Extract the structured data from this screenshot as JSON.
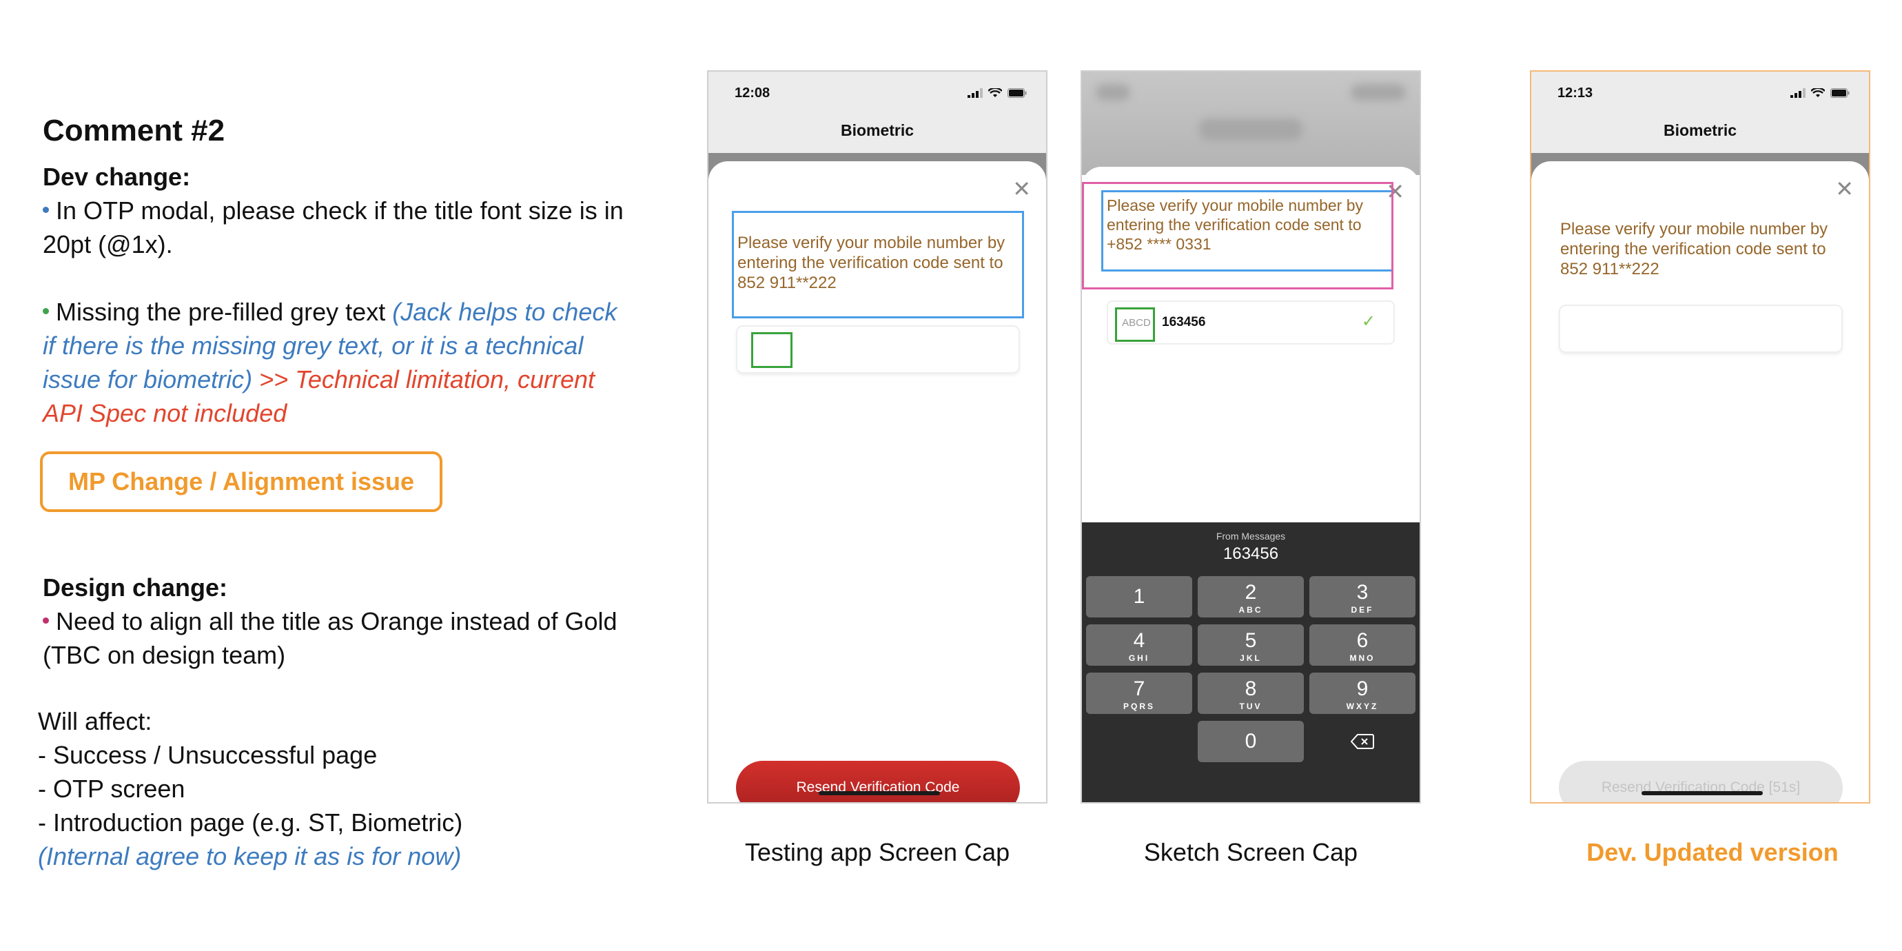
{
  "notes": {
    "title": "Comment #2",
    "dev_heading": "Dev change:",
    "dev_point1": "In OTP modal, please check if the title font size is in 20pt (@1x).",
    "dev_point2_prefix": "Missing the pre-filled grey text ",
    "dev_point2_query": "(Jack helps to check if there is the missing grey text, or it is a technical issue for biometric)",
    "dev_point2_answer": " >> Technical limitation, current API Spec not included",
    "tag_label": "MP Change / Alignment issue",
    "design_heading": "Design change:",
    "design_point": "Need to align all the title as Orange instead of Gold (TBC on design team)",
    "affect_heading": "Will affect:",
    "affect_items": [
      "- Success / Unsuccessful page",
      "- OTP screen",
      "- Introduction page (e.g. ST, Biometric)"
    ],
    "affect_note": "(Internal agree to keep it as is for now)",
    "colors": {
      "blue_bullet": "#3d7bbf",
      "green_bullet": "#3fa34d",
      "pink_bullet": "#c2306a",
      "orange": "#f19a2c",
      "red": "#e2452d",
      "gold_text": "#96662b"
    }
  },
  "testing_phone": {
    "time": "12:08",
    "title": "Biometric",
    "message": "Please verify your mobile number by entering the verification code sent to 852 911**222",
    "resend": "Resend Verification Code",
    "caption": "Testing app Screen Cap"
  },
  "sketch_phone": {
    "message": "Please verify your mobile number by entering the verification code sent to +852 **** 0331",
    "sms_tag": "ABCD",
    "sms_code": "163456",
    "keyboard_from": "From Messages",
    "keyboard_code": "163456",
    "keys": [
      {
        "n": "1",
        "l": ""
      },
      {
        "n": "2",
        "l": "ABC"
      },
      {
        "n": "3",
        "l": "DEF"
      },
      {
        "n": "4",
        "l": "GHI"
      },
      {
        "n": "5",
        "l": "JKL"
      },
      {
        "n": "6",
        "l": "MNO"
      },
      {
        "n": "7",
        "l": "PQRS"
      },
      {
        "n": "8",
        "l": "TUV"
      },
      {
        "n": "9",
        "l": "WXYZ"
      },
      {
        "n": "0",
        "l": ""
      }
    ],
    "caption": "Sketch Screen Cap"
  },
  "updated_phone": {
    "time": "12:13",
    "title": "Biometric",
    "message": "Please verify your mobile number by entering the verification code sent to 852 911**222",
    "resend": "Resend Verification Code [51s]",
    "caption": "Dev. Updated version"
  },
  "icons": {
    "close": "close-icon",
    "signal": "signal-icon",
    "wifi": "wifi-icon",
    "battery": "battery-icon",
    "check": "check-icon",
    "backspace": "backspace-icon"
  }
}
